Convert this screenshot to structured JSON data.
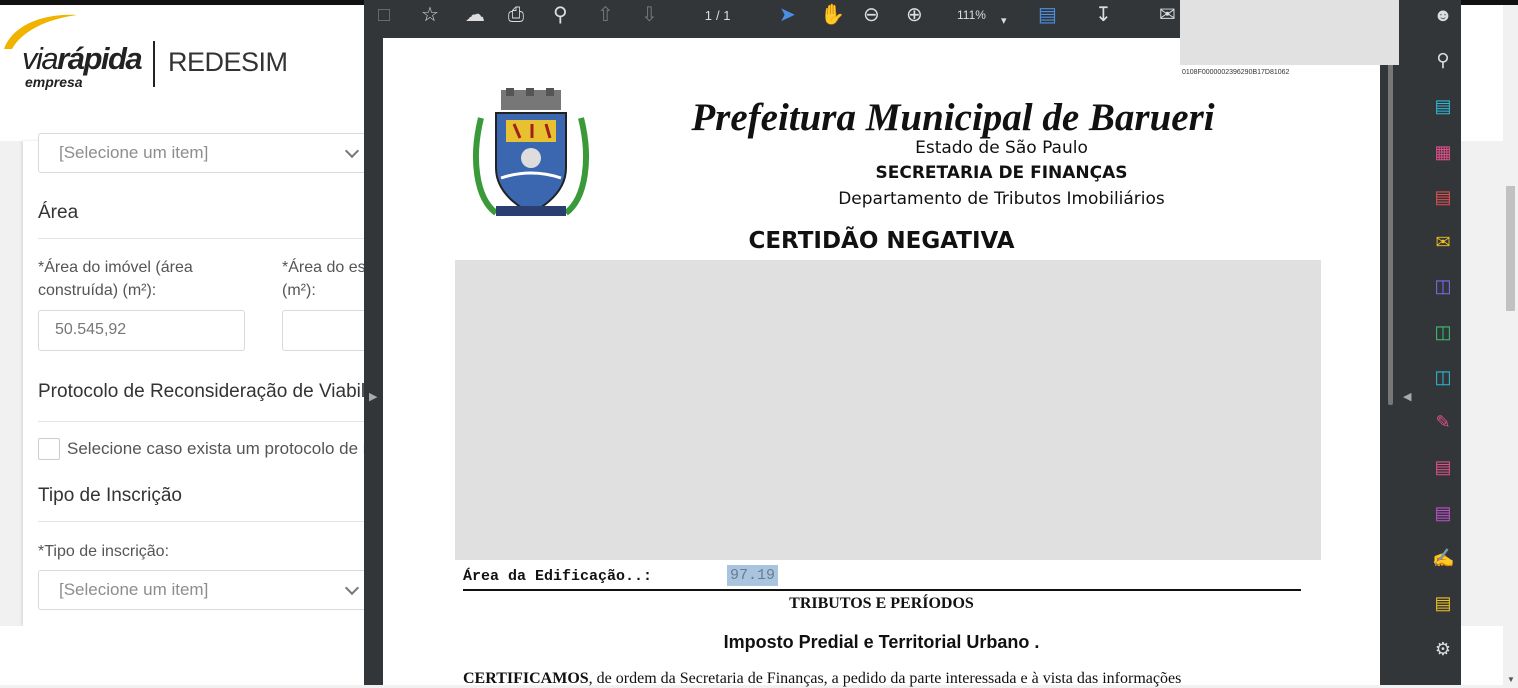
{
  "brand": {
    "logo_via": "via",
    "logo_rapida": "rápida",
    "logo_sub": "empresa",
    "redesim": "REDESIM"
  },
  "form": {
    "top_select_placeholder": "[Selecione um item]",
    "area_section": "Área",
    "area_imovel_label": "*Área do imóvel (área construída) (m²):",
    "area_es_label_line1": "*Área do es",
    "area_es_label_line2": "(m²):",
    "area_imovel_value": "50.545,92",
    "protocolo_section": "Protocolo de Reconsideração de Viabil",
    "protocolo_checkbox_label": "Selecione caso exista um protocolo de re",
    "tipo_section": "Tipo de Inscrição",
    "tipo_label": "*Tipo de inscrição:",
    "tipo_select_placeholder": "[Selecione um item]"
  },
  "viewer": {
    "page_current": "1",
    "page_total": "/ 1",
    "zoom": "111%",
    "icons": [
      "save-icon",
      "bookmark-star-icon",
      "upload-cloud-icon",
      "print-icon",
      "search-zoom-icon",
      "page-up-icon",
      "page-down-icon",
      "select-cursor-icon",
      "hand-pan-icon",
      "zoom-out-icon",
      "zoom-in-icon",
      "page-fit-icon",
      "scroll-mode-icon",
      "comment-icon"
    ],
    "side_icons": [
      "zoom-search-icon",
      "export-pdf-icon",
      "organize-pages-icon",
      "create-pdf-icon",
      "comment-tool-icon",
      "combine-files-icon",
      "compress-icon",
      "convert-icon",
      "fill-sign-icon",
      "edit-pdf-icon",
      "protect-icon",
      "signature-icon",
      "scan-icon",
      "more-tools-icon"
    ],
    "accent": "#4a90e2"
  },
  "document": {
    "id_code": "0108F0000002396290B17D81062",
    "title": "Prefeitura Municipal de Barueri",
    "state": "Estado de São Paulo",
    "secretaria": "SECRETARIA DE FINANÇAS",
    "departamento": "Departamento de Tributos Imobiliários",
    "certidao": "CERTIDÃO NEGATIVA",
    "area_label": "Área da Edificação..:",
    "area_value": "97.19",
    "tributos": "TRIBUTOS E PERÍODOS",
    "imposto": "Imposto Predial e Territorial Urbano .",
    "cert_bold": "CERTIFICAMOS",
    "cert_text": ", de ordem da Secretaria de Finanças, a pedido da parte interessada e à vista das informações"
  }
}
